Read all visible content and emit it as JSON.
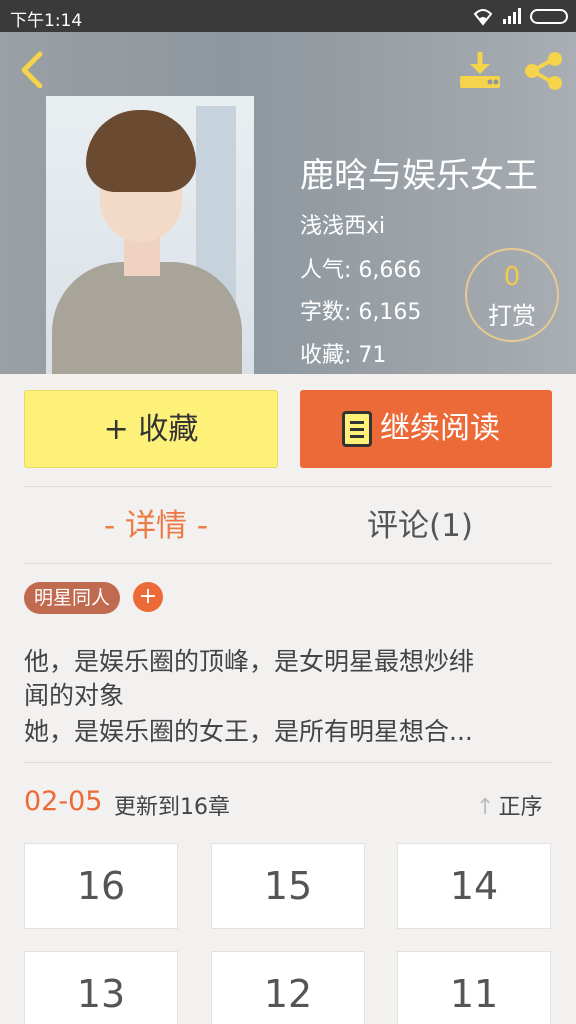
{
  "status_bar": {
    "time": "下午1:14"
  },
  "header": {
    "book_title": "鹿晗与娱乐女王",
    "author": "浅浅西xi",
    "stats": [
      {
        "label": "人气",
        "value": "6,666"
      },
      {
        "label": "字数",
        "value": "6,165"
      },
      {
        "label": "收藏",
        "value": "71"
      }
    ],
    "reward": {
      "count": "0",
      "label": "打赏"
    }
  },
  "actions": {
    "favorite_label": "+ 收藏",
    "continue_label": "继续阅读"
  },
  "tabs": {
    "detail_label": "- 详情 -",
    "comments_label": "评论(1)"
  },
  "tags": [
    {
      "label": "明星同人"
    }
  ],
  "tag_add_label": "+",
  "description": {
    "line1": "他，是娱乐圈的顶峰，是女明星最想炒绯",
    "line2": "闻的对象",
    "line3": "她，是娱乐圈的女王，是所有明星想合..."
  },
  "update": {
    "date": "02-05",
    "text": "更新到16章",
    "sort_label": "正序"
  },
  "chapters": [
    "16",
    "15",
    "14",
    "13",
    "12",
    "11"
  ],
  "colors": {
    "accent": "#ec6a37",
    "favorite_bg": "#fdf17a",
    "reward_count": "#f5c94b",
    "tag_bg": "#c06a4f"
  }
}
